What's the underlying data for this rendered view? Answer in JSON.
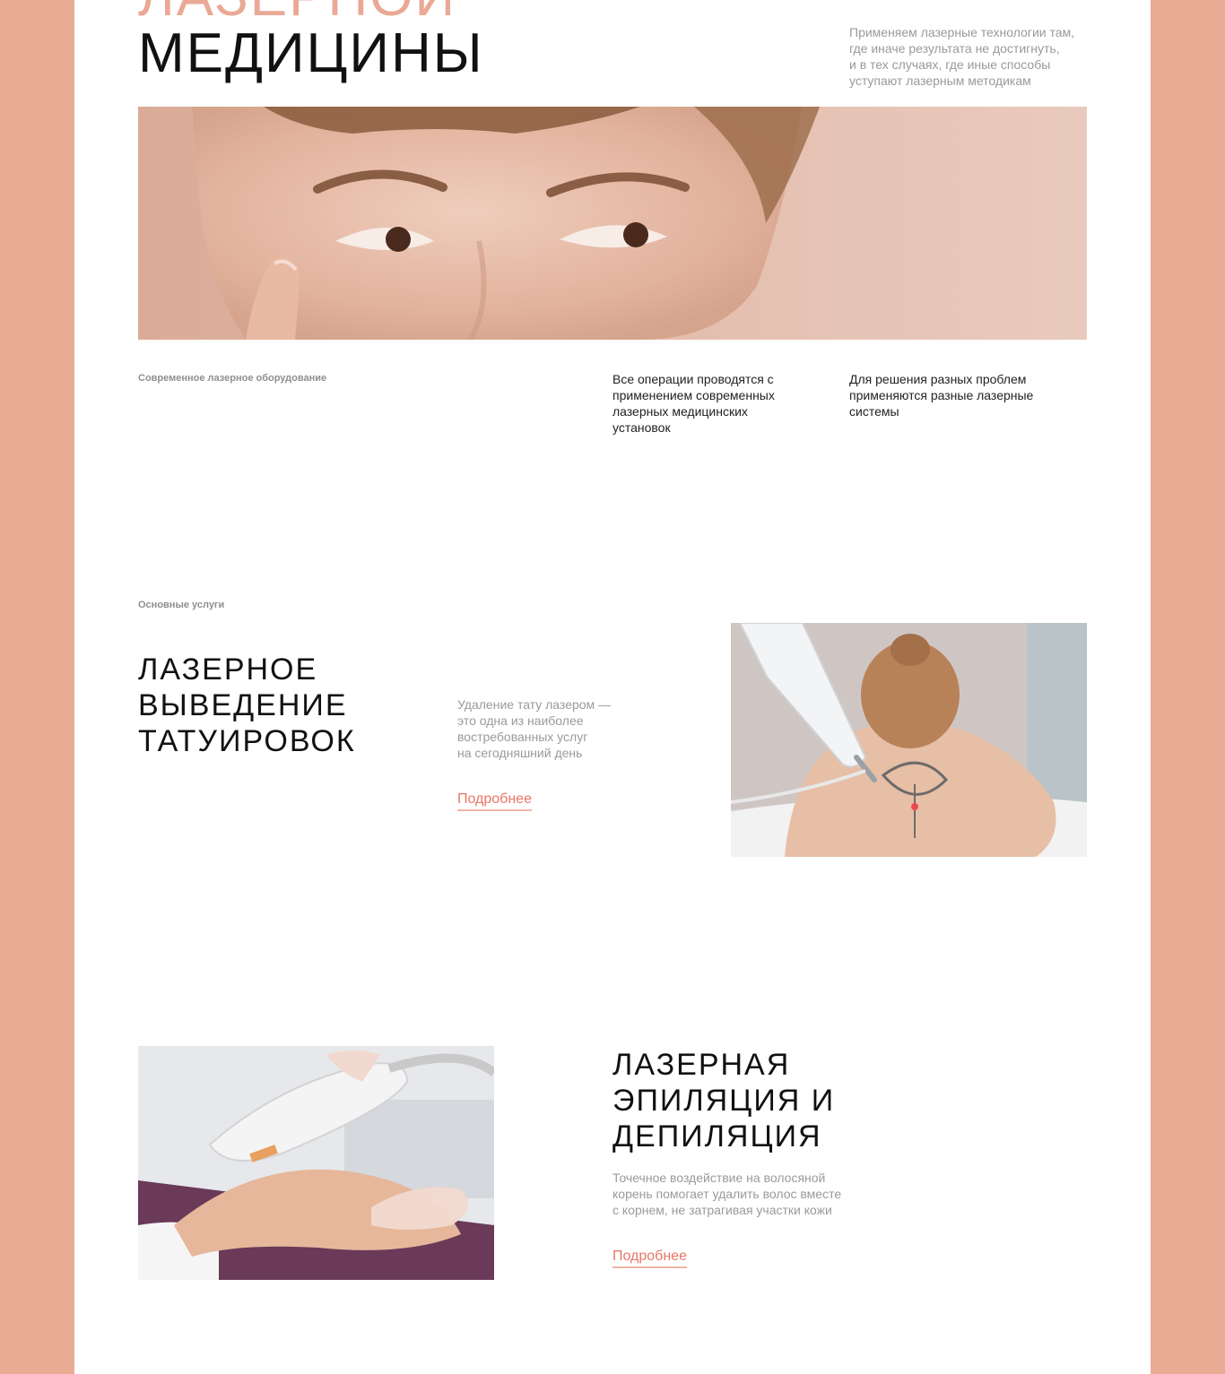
{
  "hero": {
    "title_line1": "ЛАЗЕРНОЙ",
    "title_line2": "МЕДИЦИНЫ",
    "description": [
      "Применяем лазерные технологии там,",
      "где иначе результата не достигнуть,",
      "и в тех случаях, где иные способы",
      "уступают лазерным методикам"
    ]
  },
  "equipment": {
    "caption": "Современное лазерное оборудование",
    "col1": [
      "Все операции проводятся с",
      "применением современных",
      "лазерных медицинских",
      "установок"
    ],
    "col2": [
      "Для решения разных проблем",
      "применяются разные лазерные",
      "системы"
    ]
  },
  "services": {
    "caption": "Основные услуги",
    "items": [
      {
        "title": [
          "ЛАЗЕРНОЕ",
          "ВЫВЕДЕНИЕ",
          "ТАТУИРОВОК"
        ],
        "description": [
          "Удаление тату лазером —",
          "это одна из наиболее",
          "востребованных услуг",
          "на сегодняшний день"
        ],
        "link": "Подробнее"
      },
      {
        "title": [
          "ЛАЗЕРНАЯ",
          "ЭПИЛЯЦИЯ И",
          "ДЕПИЛЯЦИЯ"
        ],
        "description": [
          "Точечное воздействие на волосяной",
          "корень помогает удалить волос вместе",
          "с корнем, не затрагивая участки кожи"
        ],
        "link": "Подробнее"
      }
    ]
  },
  "colors": {
    "background": "#e9ab94",
    "accent": "#e87566",
    "title_peach": "#eaa895"
  }
}
